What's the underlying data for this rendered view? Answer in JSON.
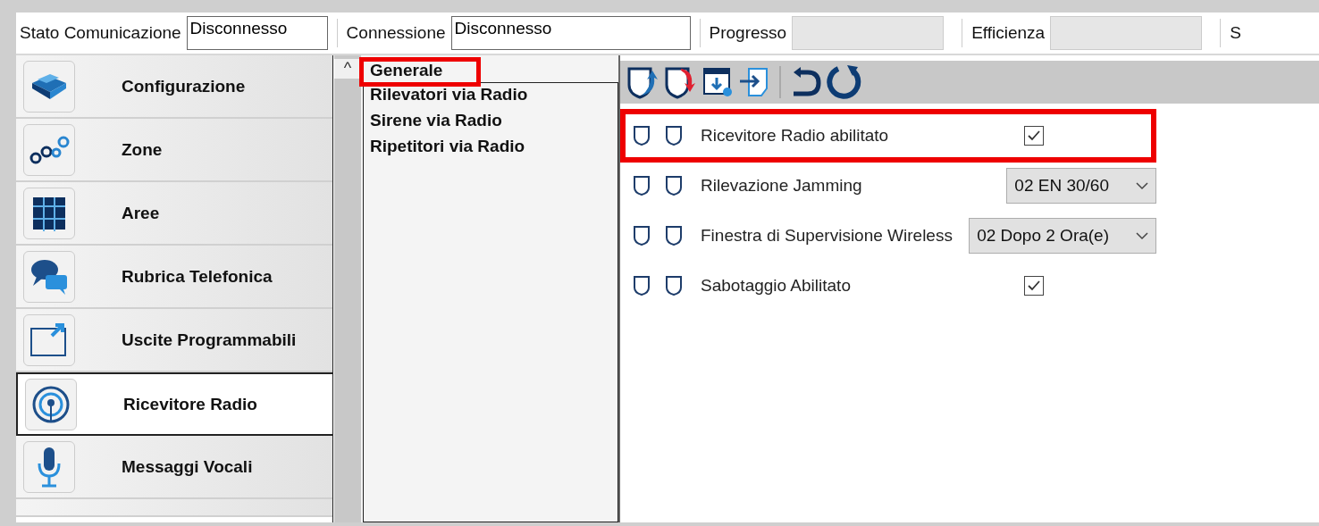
{
  "status_bar": [
    {
      "label": "Stato Comunicazione",
      "value": "Disconnesso",
      "kind": "text"
    },
    {
      "label": "Connessione",
      "value": "Disconnesso",
      "kind": "text"
    },
    {
      "label": "Progresso",
      "kind": "empty"
    },
    {
      "label": "Efficienza",
      "kind": "empty"
    },
    {
      "label": "S",
      "kind": "cut"
    }
  ],
  "sidebar": {
    "items": [
      {
        "label": "Configurazione",
        "selected": false
      },
      {
        "label": "Zone",
        "selected": false
      },
      {
        "label": "Aree",
        "selected": false
      },
      {
        "label": "Rubrica Telefonica",
        "selected": false
      },
      {
        "label": "Uscite Programmabili",
        "selected": false
      },
      {
        "label": "Ricevitore Radio",
        "selected": true
      },
      {
        "label": "Messaggi Vocali",
        "selected": false
      }
    ]
  },
  "scroll_up": "^",
  "tree": {
    "items": [
      {
        "label": "Generale",
        "highlighted": true
      },
      {
        "label": "Rilevatori via Radio",
        "highlighted": false
      },
      {
        "label": "Sirene via Radio",
        "highlighted": false
      },
      {
        "label": "Ripetitori via Radio",
        "highlighted": false
      }
    ]
  },
  "settings": [
    {
      "label": "Ricevitore Radio abilitato",
      "kind": "checkbox",
      "checked": true,
      "highlighted": true
    },
    {
      "label": "Rilevazione Jamming",
      "kind": "dropdown",
      "value": "02 EN 30/60",
      "highlighted": false
    },
    {
      "label": "Finestra di Supervisione Wireless",
      "kind": "dropdown",
      "value": "02 Dopo 2 Ora(e)",
      "highlighted": false
    },
    {
      "label": "Sabotaggio Abilitato",
      "kind": "checkbox",
      "checked": true,
      "highlighted": false
    }
  ]
}
